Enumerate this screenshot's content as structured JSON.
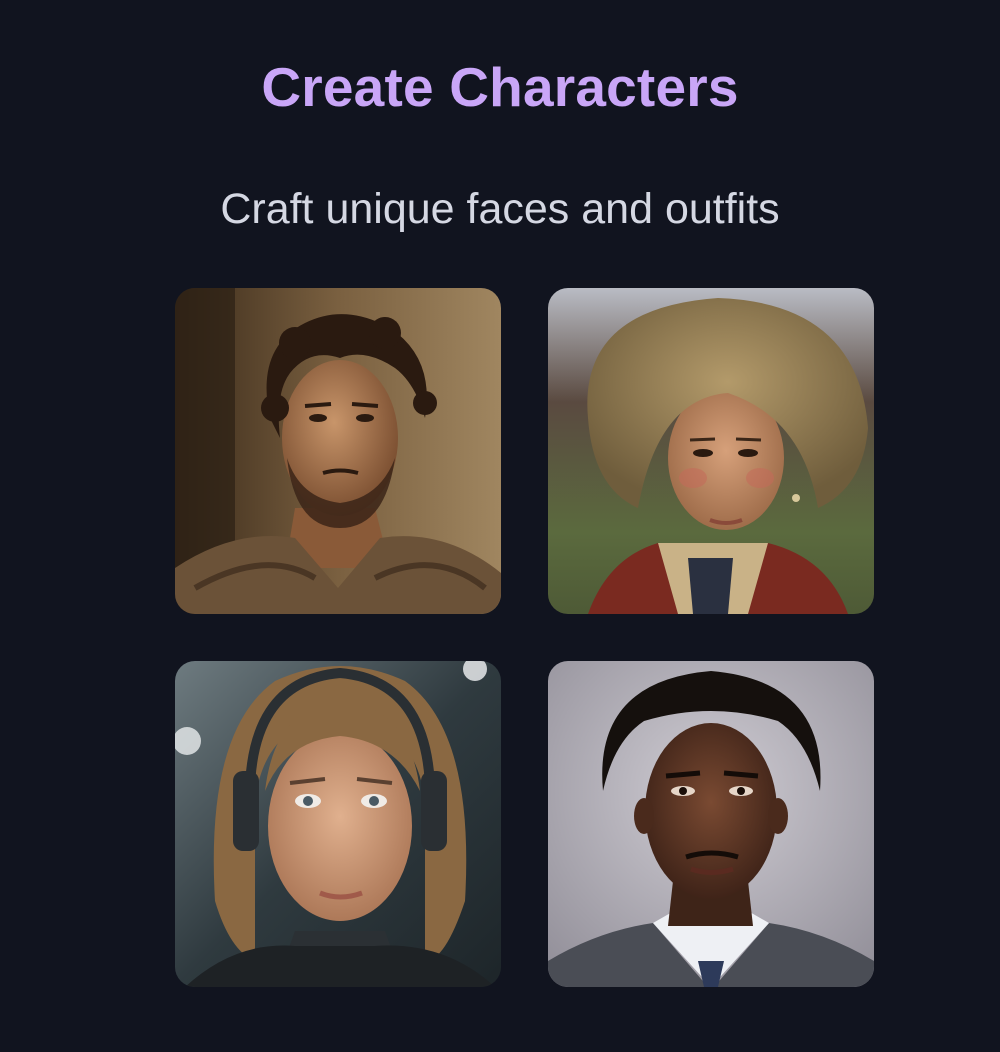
{
  "header": {
    "title": "Create Characters",
    "subtitle": "Craft unique faces and outfits"
  },
  "colors": {
    "background": "#11141f",
    "title": "#c9a6f7",
    "subtitle": "#d5d8e3"
  },
  "gallery": {
    "portraits": [
      {
        "name": "portrait-curly-haired-man"
      },
      {
        "name": "portrait-woman-fur-hat"
      },
      {
        "name": "portrait-woman-headphones"
      },
      {
        "name": "portrait-man-suit"
      }
    ]
  }
}
